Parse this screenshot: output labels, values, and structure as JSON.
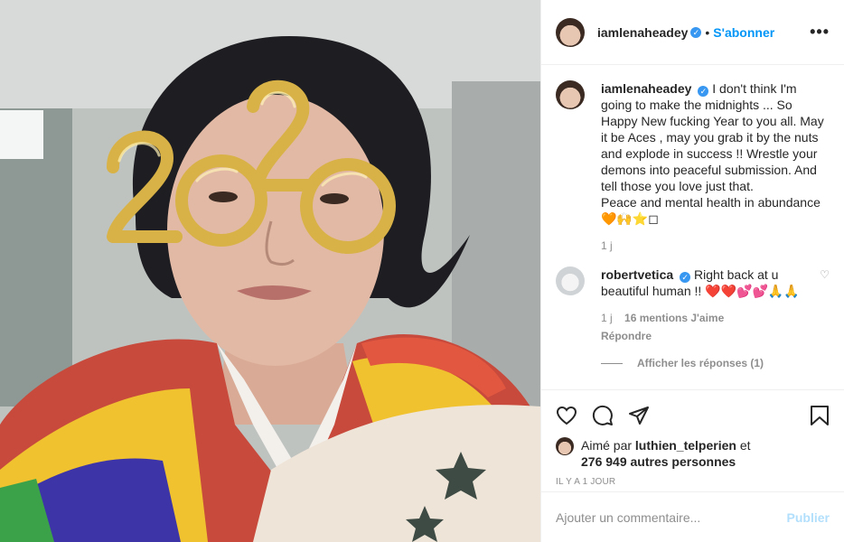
{
  "post": {
    "username": "iamlenaheadey",
    "follow_label": "S'abonner",
    "separator": "•",
    "more_label": "•••",
    "verified_mark": "✓",
    "caption": "I don't think I'm going to make the midnights ... So Happy New fucking Year to you all. May it be Aces , may you grab it by the nuts and explode in success !! Wrestle your demons into peaceful submission. And tell those you love just that.\nPeace and mental health in abundance\n🧡🙌⭐◻",
    "caption_age": "1 j",
    "photo_glasses_text": "2020"
  },
  "reply": {
    "username": "robertvetica",
    "text": "Right back at u beautiful human !! ❤️❤️💕💕🙏🙏",
    "age": "1 j",
    "likes": "16 mentions J'aime",
    "reply_label": "Répondre",
    "view_replies_label": "Afficher les réponses (1)",
    "heart_icon": "♡"
  },
  "actions": {
    "like_icon": "heart-icon",
    "comment_icon": "comment-icon",
    "share_icon": "share-icon",
    "save_icon": "bookmark-icon"
  },
  "likes": {
    "prefix": "Aimé par",
    "user": "luthien_telperien",
    "conjunction": "et",
    "others": "276 949 autres personnes"
  },
  "time_ago": "IL Y A 1 JOUR",
  "add_comment": {
    "placeholder": "Ajouter un commentaire...",
    "publish_label": "Publier"
  },
  "colors": {
    "accent": "#0095f6",
    "publish_disabled": "#b2dffc",
    "verified": "#3897f0",
    "muted": "#8e8e8e"
  }
}
